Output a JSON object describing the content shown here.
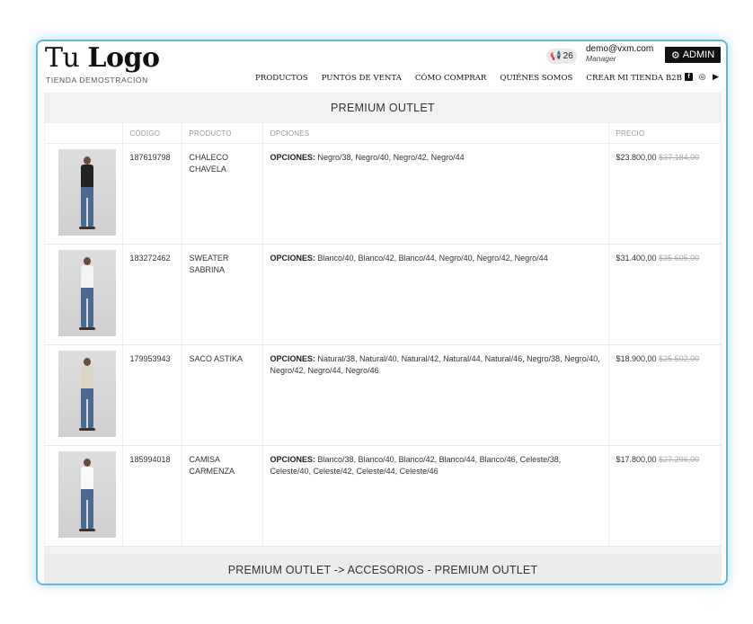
{
  "brand": {
    "logo_light": "Tu ",
    "logo_bold": "Logo",
    "tagline": "TIENDA DEMOSTRACIÓN"
  },
  "notifications": {
    "icon": "megaphone-icon",
    "count": "26"
  },
  "user": {
    "email": "demo@vxm.com",
    "role": "Manager"
  },
  "admin_button": {
    "icon": "gears-icon",
    "label": "ADMIN"
  },
  "nav": {
    "items": [
      "PRODUCTOS",
      "PUNTOS DE VENTA",
      "CÓMO COMPRAR",
      "QUIÉNES SOMOS",
      "CREAR MI TIENDA B2B"
    ]
  },
  "social": {
    "icons": [
      "facebook-icon",
      "instagram-icon",
      "youtube-icon"
    ]
  },
  "section": {
    "title": "PREMIUM OUTLET"
  },
  "table": {
    "headers": {
      "code": "CÓDIGO",
      "product": "PRODUCTO",
      "options": "OPCIONES",
      "price": "PRECIO"
    },
    "options_label": "OPCIONES:",
    "rows": [
      {
        "code": "187619798",
        "product": "CHALECO CHAVELA",
        "options": "Negro/38, Negro/40, Negro/42, Negro/44",
        "price": "$23.800,00",
        "old_price": "$37.184,00",
        "top_color": "#222222"
      },
      {
        "code": "183272462",
        "product": "SWEATER SABRINA",
        "options": "Blanco/40, Blanco/42, Blanco/44, Negro/40, Negro/42, Negro/44",
        "price": "$31.400,00",
        "old_price": "$35.605,00",
        "top_color": "#f4f4f4"
      },
      {
        "code": "179953943",
        "product": "SACO ASTIKA",
        "options": "Natural/38, Natural/40, Natural/42, Natural/44, Natural/46, Negro/38, Negro/40, Negro/42, Negro/44, Negro/46",
        "price": "$18.900,00",
        "old_price": "$25.502,00",
        "top_color": "#d9d4c4"
      },
      {
        "code": "185994018",
        "product": "CAMISA CARMENZA",
        "options": "Blanco/38, Blanco/40, Blanco/42, Blanco/44, Blanco/46, Celeste/38, Celeste/40, Celeste/42, Celeste/44, Celeste/46",
        "price": "$17.800,00",
        "old_price": "$27.296,00",
        "top_color": "#fafafa"
      }
    ]
  },
  "next_section": {
    "title": "PREMIUM OUTLET -> ACCESORIOS - PREMIUM OUTLET"
  },
  "colors": {
    "frame_border": "#63b6e6",
    "admin_bg": "#111111",
    "section_bg": "#f2f2f2"
  }
}
